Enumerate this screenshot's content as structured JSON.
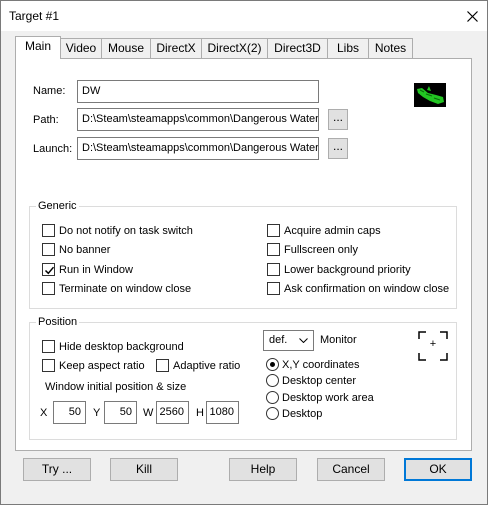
{
  "window": {
    "title": "Target #1"
  },
  "tabs": [
    "Main",
    "Video",
    "Mouse",
    "DirectX",
    "DirectX(2)",
    "Direct3D",
    "Libs",
    "Notes"
  ],
  "main": {
    "name_label": "Name:",
    "name_value": "DW",
    "path_label": "Path:",
    "path_value": "D:\\Steam\\steamapps\\common\\Dangerous Waters\\",
    "launch_label": "Launch:",
    "launch_value": "D:\\Steam\\steamapps\\common\\Dangerous Waters\\",
    "browse_label": "...",
    "app_icon": "submarine-icon"
  },
  "generic": {
    "title": "Generic",
    "options": [
      {
        "label": "Do not notify on task switch",
        "checked": false
      },
      {
        "label": "No banner",
        "checked": false
      },
      {
        "label": "Run in Window",
        "checked": true
      },
      {
        "label": "Terminate on window close",
        "checked": false
      },
      {
        "label": "Acquire admin caps",
        "checked": false
      },
      {
        "label": "Fullscreen only",
        "checked": false
      },
      {
        "label": "Lower background priority",
        "checked": false
      },
      {
        "label": "Ask confirmation on window close",
        "checked": false
      }
    ]
  },
  "position": {
    "title": "Position",
    "hide_desktop": {
      "label": "Hide desktop background",
      "checked": false
    },
    "keep_aspect": {
      "label": "Keep aspect ratio",
      "checked": false
    },
    "adaptive": {
      "label": "Adaptive ratio",
      "checked": false
    },
    "initial_label": "Window initial position & size",
    "x_label": "X",
    "x_value": "50",
    "y_label": "Y",
    "y_value": "50",
    "w_label": "W",
    "w_value": "2560",
    "h_label": "H",
    "h_value": "1080",
    "monitor_select": "def.",
    "monitor_label": "Monitor",
    "crosshair_label": "+",
    "radios": [
      {
        "label": "X,Y coordinates",
        "selected": true
      },
      {
        "label": "Desktop center",
        "selected": false
      },
      {
        "label": "Desktop work area",
        "selected": false
      },
      {
        "label": "Desktop",
        "selected": false
      }
    ]
  },
  "buttons": {
    "try": "Try ...",
    "kill": "Kill",
    "help": "Help",
    "cancel": "Cancel",
    "ok": "OK"
  },
  "colors": {
    "accent": "#0078d7",
    "icon_green": "#22c522"
  }
}
